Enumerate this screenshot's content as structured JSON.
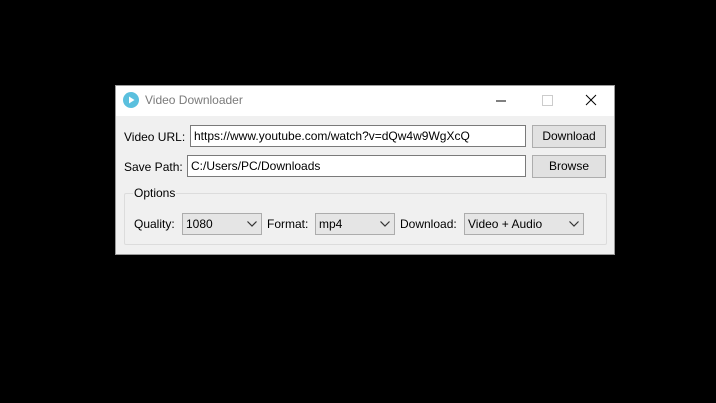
{
  "window": {
    "title": "Video Downloader",
    "icon": "play-circle-icon",
    "accent_color": "#5bc0de"
  },
  "url_row": {
    "label": "Video URL:",
    "value": "https://www.youtube.com/watch?v=dQw4w9WgXcQ",
    "button_label": "Download"
  },
  "path_row": {
    "label": "Save Path:",
    "value": "C:/Users/PC/Downloads",
    "button_label": "Browse"
  },
  "options": {
    "title": "Options",
    "quality": {
      "label": "Quality:",
      "selected": "1080"
    },
    "format": {
      "label": "Format:",
      "selected": "mp4"
    },
    "download": {
      "label": "Download:",
      "selected": "Video + Audio"
    }
  }
}
